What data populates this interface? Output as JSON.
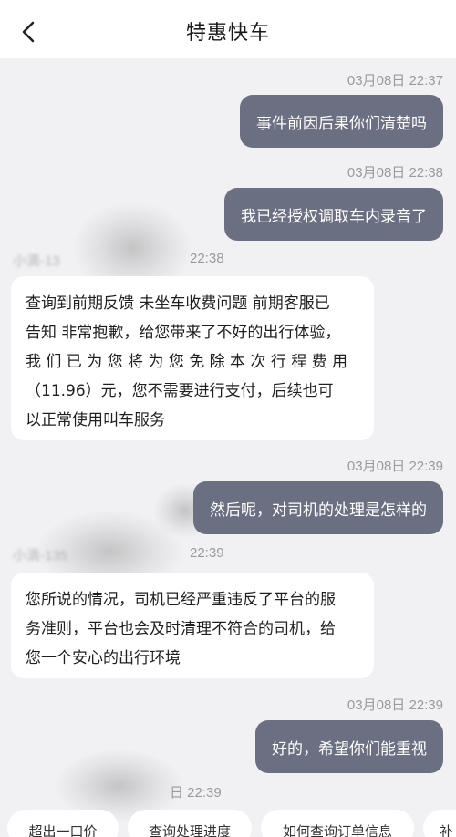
{
  "header": {
    "title": "特惠快车",
    "back_icon": "chevron-left-icon"
  },
  "messages": [
    {
      "type": "outgoing",
      "time": "03月08日 22:37",
      "text": "事件前因后果你们清楚吗"
    },
    {
      "type": "outgoing",
      "time": "03月08日 22:38",
      "text": "我已经授权调取车内录音了"
    },
    {
      "type": "incoming",
      "sender": "小滴-13",
      "time": "22:38",
      "lines": [
        "查询到前期反馈 未坐车收费问题 前期客服已",
        "告知 非常抱歉，给您带来了不好的出行体验，",
        "我 们 已 为 您 将 为 您 免 除 本 次 行 程 费 用",
        "（11.96）元，您不需要进行支付，后续也可",
        "以正常使用叫车服务"
      ]
    },
    {
      "type": "outgoing",
      "time": "03月08日 22:39",
      "text": "然后呢，对司机的处理是怎样的"
    },
    {
      "type": "incoming",
      "sender": "小滴-135",
      "time": "22:39",
      "lines": [
        "您所说的情况，司机已经严重违反了平台的服",
        "务准则，平台也会及时清理不符合的司机，给",
        "您一个安心的出行环境"
      ]
    },
    {
      "type": "outgoing",
      "time": "03月08日 22:39",
      "text": "好的，希望你们能重视"
    },
    {
      "type": "incoming-time",
      "time": "日 22:39"
    }
  ],
  "quick_replies": [
    "超出一口价",
    "查询处理进度",
    "如何查询订单信息",
    "补"
  ]
}
